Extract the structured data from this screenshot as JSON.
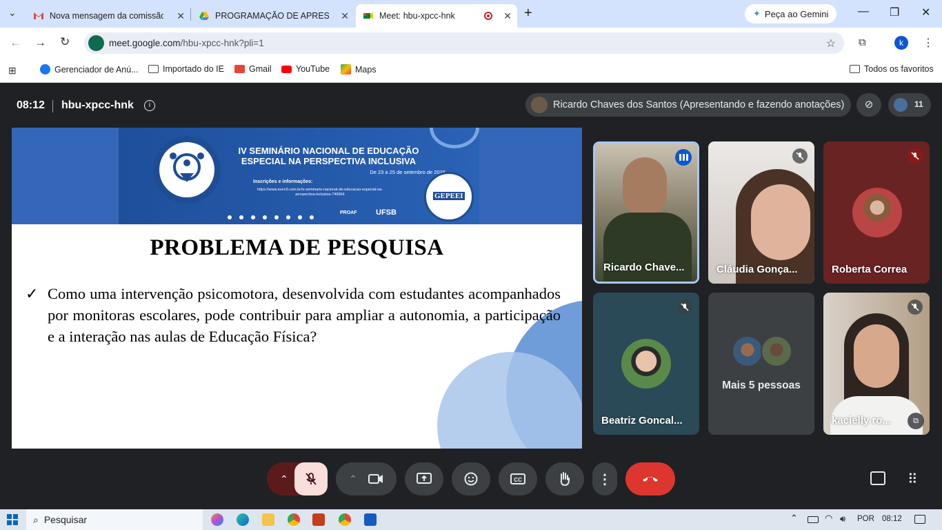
{
  "browser": {
    "tabs": [
      {
        "title": "Nova mensagem da comissão d",
        "icon": "gmail-icon"
      },
      {
        "title": "PROGRAMAÇÃO DE APRESENTA",
        "icon": "drive-icon"
      },
      {
        "title": "Meet: hbu-xpcc-hnk",
        "icon": "meet-icon",
        "active": true
      }
    ],
    "gemini_label": "Peça ao Gemini",
    "url_host": "meet.google.com",
    "url_path": "/hbu-xpcc-hnk?pli=1",
    "profile_initial": "k",
    "bookmarks": [
      "Gerenciador de Anú...",
      "Importado do IE",
      "Gmail",
      "YouTube",
      "Maps"
    ],
    "all_bookmarks": "Todos os favoritos"
  },
  "meet": {
    "time": "08:12",
    "room": "hbu-xpcc-hnk",
    "presenter": "Ricardo Chaves dos Santos (Apresentando e fazendo anotações)",
    "participant_count": "11",
    "tiles": [
      {
        "name": "Ricardo Chave...",
        "state": "speaking"
      },
      {
        "name": "Cláudia Gonça...",
        "state": "muted"
      },
      {
        "name": "Roberta Correa",
        "state": "muted-red"
      },
      {
        "name": "Beatriz Goncal...",
        "state": "muted"
      },
      {
        "name": "Mais 5 pessoas",
        "state": "group"
      },
      {
        "name": "kacielly ro...",
        "state": "muted"
      }
    ]
  },
  "slide": {
    "banner_title_1": "IV SEMINÁRIO NACIONAL DE EDUCAÇÃO",
    "banner_title_2": "ESPECIAL NA PERSPECTIVA INCLUSIVA",
    "banner_date": "De 23 a 25 de setembro de 2026",
    "banner_info": "Inscrições e informações:",
    "banner_link": "https://www.even3.com.br/iv-seminario-nacional-de-educacao-especial-na-perspectiva-inclusiva-749964",
    "banner_org": "GEPEEI",
    "banner_proaf": "PROAF",
    "banner_ufsb": "UFSB",
    "title": "PROBLEMA DE PESQUISA",
    "bullet": "✓",
    "question": "Como uma intervenção psicomotora, desenvolvida com estudantes acompanhados por monitoras escolares, pode contribuir para ampliar a autonomia, a participação e a interação nas aulas de Educação Física?"
  },
  "taskbar": {
    "search_placeholder": "Pesquisar",
    "language": "POR",
    "time": "08:12"
  },
  "colors": {
    "meet_bg": "#202124",
    "hangup_red": "#dc362e",
    "mic_off_pink": "#f9dedc",
    "speaking_blue": "#0b57d0"
  }
}
